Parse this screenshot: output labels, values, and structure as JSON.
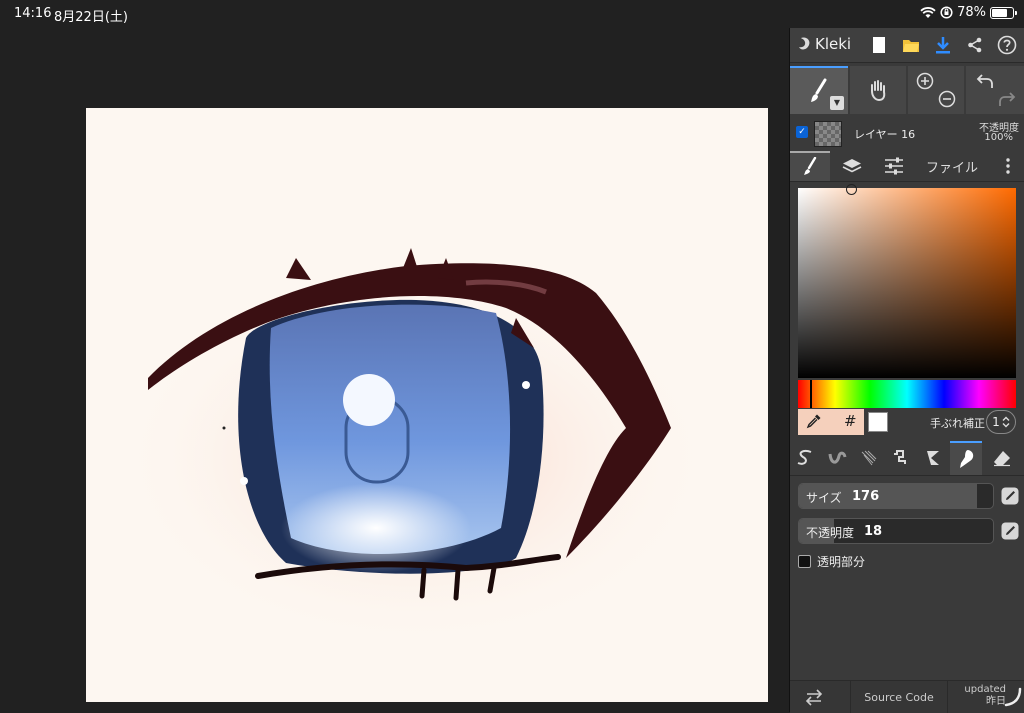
{
  "status": {
    "time": "14:16",
    "date": "8月22日(土)",
    "battery": "78%",
    "battery_level": 0.78
  },
  "app": {
    "name": "Kleki"
  },
  "layer": {
    "name": "レイヤー 16",
    "opacity_label": "不透明度",
    "opacity_value": "100%"
  },
  "tabs": {
    "file": "ファイル"
  },
  "color": {
    "current": "#f5d0bc",
    "hash": "#",
    "stabilizer_label": "手ぶれ補正",
    "stabilizer_value": "1"
  },
  "brush": {
    "size_label": "サイズ",
    "size_value": "176",
    "size_fraction": 0.92,
    "opacity_label": "不透明度",
    "opacity_value": "18",
    "opacity_fraction": 0.18,
    "transparent_label": "透明部分"
  },
  "footer": {
    "source_code": "Source Code",
    "updated": "updated",
    "updated_when": "昨日"
  }
}
